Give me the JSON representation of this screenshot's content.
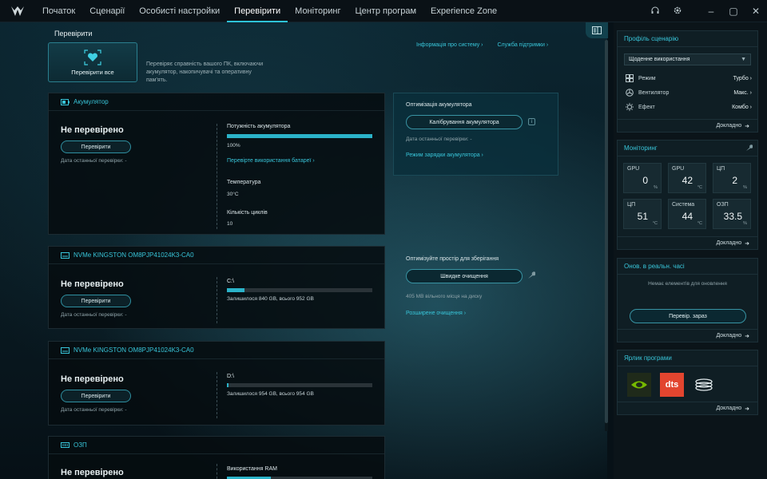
{
  "nav": {
    "items": [
      "Початок",
      "Сценарії",
      "Особисті настройки",
      "Перевірити",
      "Моніторинг",
      "Центр програм",
      "Experience Zone"
    ],
    "active_index": 3
  },
  "page": {
    "title": "Перевірити",
    "check_all_label": "Перевірити все",
    "check_all_desc": "Перевіряє справність вашого ПК, включаючи акумулятор, накопичувачі та оперативну пам'ять.",
    "link_sysinfo": "Інформація про систему ›",
    "link_support": "Служба підтримки ›"
  },
  "battery": {
    "title": "Акумулятор",
    "status": "Не перевірено",
    "check_btn": "Перевірити",
    "last_check": "Дата останньої перевірки: -",
    "capacity_label": "Потужність акумулятора",
    "capacity_value": "100%",
    "capacity_fraction": 1.0,
    "usage_link": "Перевірте використання батареї ›",
    "temp_label": "Температура",
    "temp_value": "30°C",
    "cycles_label": "Кількість циклів",
    "cycles_value": "10"
  },
  "battery_opt": {
    "title": "Оптимізація акумулятора",
    "calibrate_btn": "Калібрування акумулятора",
    "last_check": "Дата останньої перевірки: -",
    "charge_link": "Режим зарядки акумулятора ›"
  },
  "disk1": {
    "title": "NVMe KINGSTON OM8PJP41024K3-CA0",
    "status": "Не перевірено",
    "check_btn": "Перевірити",
    "last_check": "Дата останньої перевірки: -",
    "drive": "C:\\",
    "used_fraction": 0.12,
    "space": "Залишилося 840 GB, всього 952 GB"
  },
  "storage_opt": {
    "title": "Оптимізуйте простір для зберігання",
    "clean_btn": "Швидке очищення",
    "free": "405 MB вільного місця на диску",
    "adv_link": "Розширене очищення ›"
  },
  "disk2": {
    "title": "NVMe KINGSTON OM8PJP41024K3-CA0",
    "status": "Не перевірено",
    "check_btn": "Перевірити",
    "last_check": "Дата останньої перевірки: -",
    "drive": "D:\\",
    "used_fraction": 0.01,
    "space": "Залишилося 954 GB, всього 954 GB"
  },
  "ram": {
    "title": "ОЗП",
    "status": "Не перевірено",
    "usage_label": "Використання RAM",
    "used_fraction": 0.3
  },
  "profile": {
    "title": "Профіль сценарію",
    "selected": "Щоденне використання",
    "rows": [
      {
        "icon": "mode-icon",
        "key": "Режим",
        "value": "Турбо ›"
      },
      {
        "icon": "fan-icon",
        "key": "Вентилятор",
        "value": "Макс. ›"
      },
      {
        "icon": "effect-icon",
        "key": "Ефект",
        "value": "Комбо ›"
      }
    ],
    "more": "Докладно"
  },
  "monitoring": {
    "title": "Моніторинг",
    "tiles": [
      {
        "name": "GPU",
        "value": "0",
        "unit": "%"
      },
      {
        "name": "GPU",
        "value": "42",
        "unit": "°C"
      },
      {
        "name": "ЦП",
        "value": "2",
        "unit": "%"
      },
      {
        "name": "ЦП",
        "value": "51",
        "unit": "°C"
      },
      {
        "name": "Система",
        "value": "44",
        "unit": "°C"
      },
      {
        "name": "ОЗП",
        "value": "33.5",
        "unit": "%"
      }
    ],
    "more": "Докладно"
  },
  "updates": {
    "title": "Онов. в реальн. часі",
    "empty": "Немає елементів для оновлення",
    "check_btn": "Перевір. зараз",
    "more": "Докладно"
  },
  "shortcuts": {
    "title": "Ярлик програми",
    "apps": [
      "nvidia-icon",
      "dts-icon",
      "coil-icon"
    ],
    "dts_text": "dts",
    "more": "Докладно"
  },
  "colors": {
    "accent": "#2ec3d8",
    "link": "#38c5d9"
  }
}
